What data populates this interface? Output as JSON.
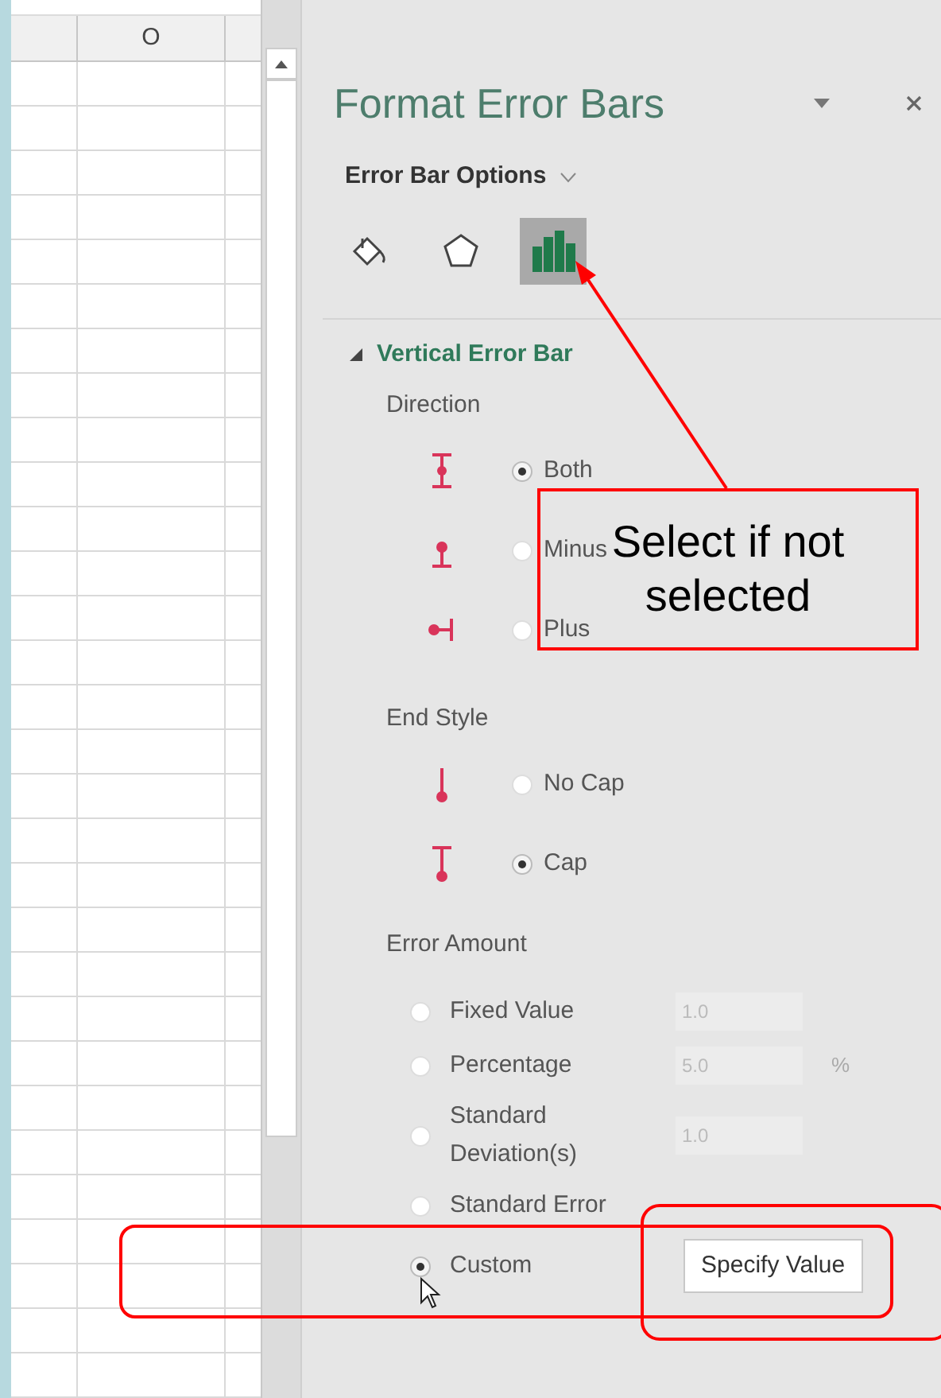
{
  "spreadsheet": {
    "column_header": "O"
  },
  "panel": {
    "title": "Format Error Bars",
    "options_label": "Error Bar Options",
    "tabs": [
      {
        "kind": "fill",
        "selected": false
      },
      {
        "kind": "effects",
        "selected": false
      },
      {
        "kind": "options",
        "selected": true
      }
    ],
    "section": {
      "title": "Vertical Error Bar",
      "expanded": true
    },
    "direction": {
      "heading": "Direction",
      "options": [
        {
          "label": "Both",
          "kind": "both",
          "selected": true
        },
        {
          "label": "Minus",
          "kind": "minus",
          "selected": false
        },
        {
          "label": "Plus",
          "kind": "plus",
          "selected": false
        }
      ]
    },
    "end_style": {
      "heading": "End Style",
      "options": [
        {
          "label": "No Cap",
          "kind": "nocap",
          "selected": false
        },
        {
          "label": "Cap",
          "kind": "cap",
          "selected": true
        }
      ]
    },
    "error_amount": {
      "heading": "Error Amount",
      "options": [
        {
          "label": "Fixed Value",
          "selected": false,
          "value": "1.0"
        },
        {
          "label": "Percentage",
          "selected": false,
          "value": "5.0",
          "unit": "%"
        },
        {
          "label": "Standard Deviation(s)",
          "selected": false,
          "value": "1.0"
        },
        {
          "label": "Standard Error",
          "selected": false
        },
        {
          "label": "Custom",
          "selected": true,
          "button": "Specify Value"
        }
      ]
    }
  },
  "annotation": {
    "callout": "Select if not selected"
  }
}
